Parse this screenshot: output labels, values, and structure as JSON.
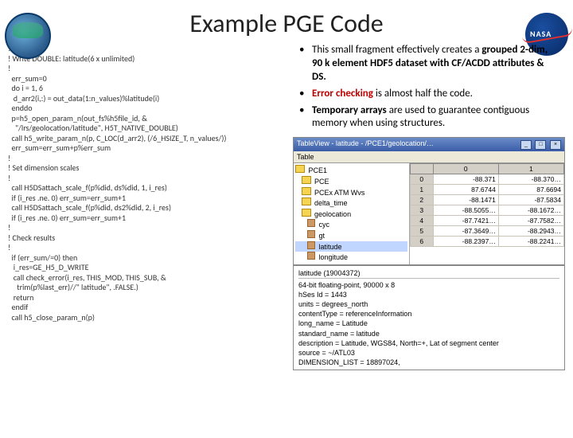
{
  "title": "Example PGE Code",
  "code": "!\n! Write DOUBLE: latitude(6 x unlimited)\n!\n  err_sum=0\n  do i = 1, 6\n   d_arr2(i,:) = out_data(1:n_values)%latitude(i)\n  enddo\n  p=h5_open_param_n(out_fs%h5file_id, &\n    \"/lrs/geolocation/latitude\", H5T_NATIVE_DOUBLE)\n  call h5_write_param_n(p, C_LOC(d_arr2), (/6_HSIZE_T, n_values/))\n  err_sum=err_sum+p%err_sum\n!\n! Set dimension scales\n!\n  call H5DSattach_scale_f(p%did, ds%did, 1, i_res)\n  if (i_res .ne. 0) err_sum=err_sum+1\n  call H5DSattach_scale_f(p%did, ds2%did, 2, i_res)\n  if (i_res .ne. 0) err_sum=err_sum+1\n!\n! Check results\n!\n  if (err_sum/=0) then\n   i_res=GE_H5_D_WRITE\n   call check_error(i_res, THIS_MOD, THIS_SUB, &\n     trim(p%last_err)//\" latitude\", .FALSE.)\n   return\n  endif\n  call h5_close_param_n(p)",
  "bullets": {
    "b1_pre": "This small fragment effectively creates a ",
    "b1_bold": "grouped 2-dim, 90 k element HDF5 dataset with CF/ACDD attributes & DS.",
    "b2_bold": "Error checking",
    "b2_rest": " is almost half the code.",
    "b3_bold": "Temporary arrays",
    "b3_rest": " are used to guarantee contiguous memory when using structures."
  },
  "panel": {
    "title": "TableView - latitude - /PCE1/geolocation/…",
    "toolbar": "Table",
    "tree": [
      {
        "indent": 0,
        "icon": "folder",
        "label": "PCE1",
        "sel": false
      },
      {
        "indent": 1,
        "icon": "folder",
        "label": "PCE",
        "sel": false
      },
      {
        "indent": 1,
        "icon": "folder",
        "label": "PCEx ATM Wvs",
        "sel": false
      },
      {
        "indent": 1,
        "icon": "folder",
        "label": "delta_time",
        "sel": false
      },
      {
        "indent": 1,
        "icon": "folder",
        "label": "geolocation",
        "sel": false
      },
      {
        "indent": 2,
        "icon": "cube",
        "label": "cyc",
        "sel": false
      },
      {
        "indent": 2,
        "icon": "cube",
        "label": "gt",
        "sel": false
      },
      {
        "indent": 2,
        "icon": "cube",
        "label": "latitude",
        "sel": true
      },
      {
        "indent": 2,
        "icon": "cube",
        "label": "longitude",
        "sel": false
      }
    ],
    "grid": {
      "cols": [
        "0",
        "1"
      ],
      "rows": [
        {
          "n": "0",
          "v": [
            "-88.371",
            "-88.370…"
          ]
        },
        {
          "n": "1",
          "v": [
            "87.6744",
            "87.6694"
          ]
        },
        {
          "n": "2",
          "v": [
            "-88.1471",
            "-87.5834"
          ]
        },
        {
          "n": "3",
          "v": [
            "-88.5055…",
            "-88.1672…"
          ]
        },
        {
          "n": "4",
          "v": [
            "-87.7421…",
            "-87.7582…"
          ]
        },
        {
          "n": "5",
          "v": [
            "-87.3649…",
            "-88.2943…"
          ]
        },
        {
          "n": "6",
          "v": [
            "-88.2397…",
            "-88.2241…"
          ]
        }
      ]
    },
    "meta": {
      "name": "latitude (19004372)",
      "line1": "64-bit floating-point, 90000 x 8",
      "line2": "hSes Id = 1443",
      "line3": "units = degrees_north",
      "line4": "contentType = referenceInformation",
      "line5": "long_name = Latitude",
      "line6": "standard_name = latitude",
      "line7": "description = Latitude, WGS84, North=+, Lat of segment center",
      "line8": "source = ~/ATL03",
      "line9": "DIMENSION_LIST = 18897024,"
    }
  }
}
